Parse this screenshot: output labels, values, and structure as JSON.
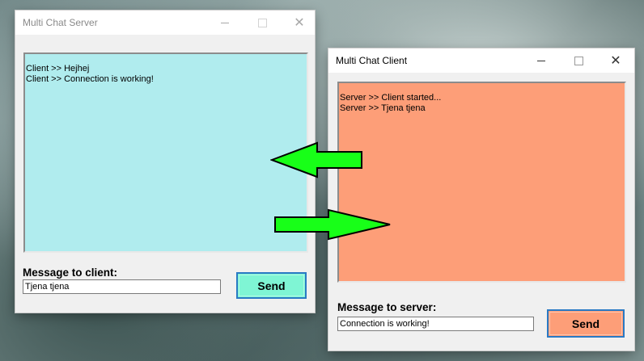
{
  "server": {
    "title": "Multi Chat Server",
    "messages": [
      "Client >> Hejhej",
      "Client >> Connection is working!"
    ],
    "message_label": "Message to client:",
    "input_value": "Tjena tjena",
    "send_label": "Send",
    "chat_color": "#b0ecee",
    "button_color": "#7ff5d4"
  },
  "client": {
    "title": "Multi Chat Client",
    "messages": [
      "Server >> Client started...",
      "Server >> Tjena tjena"
    ],
    "message_label": "Message to server:",
    "input_value": "Connection is working!",
    "send_label": "Send",
    "chat_color": "#fd9e78",
    "button_color": "#fd9e78"
  },
  "arrow_color": "#18ff18",
  "icons": [
    "minimize-icon",
    "maximize-icon",
    "close-icon",
    "arrow-left-icon",
    "arrow-right-icon"
  ]
}
